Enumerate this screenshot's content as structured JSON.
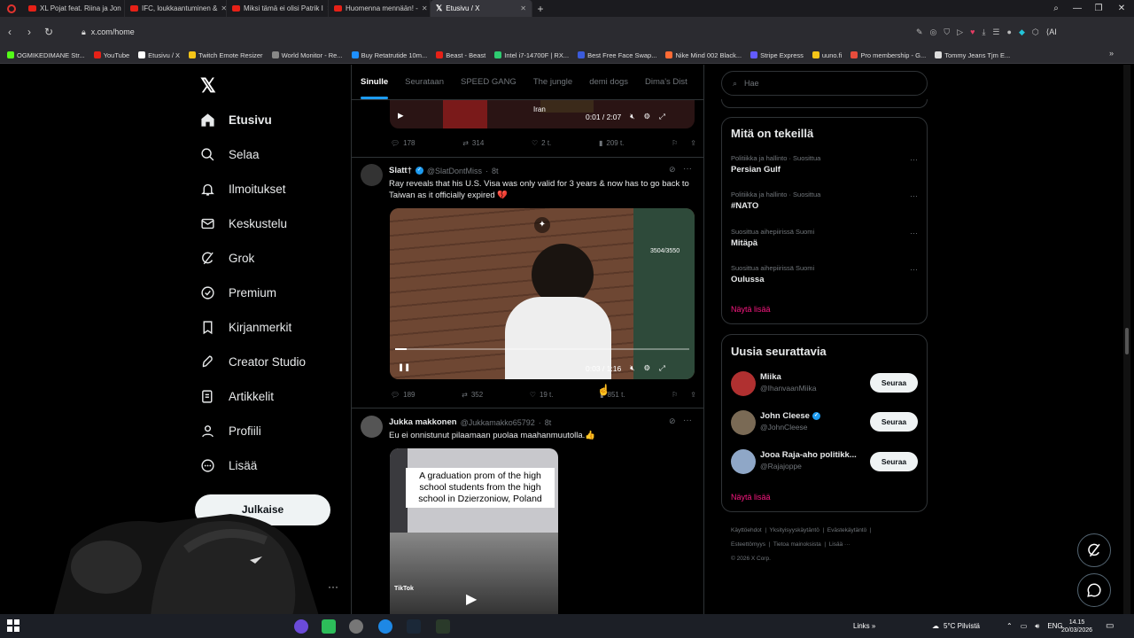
{
  "browser": {
    "tabs": [
      {
        "title": "XL Pojat feat. Riina ja Jon",
        "icon": "youtube-icon"
      },
      {
        "title": "IFC, loukkaantuminen &",
        "icon": "youtube-icon"
      },
      {
        "title": "Miksi tämä ei olisi Patrik I",
        "icon": "youtube-icon"
      },
      {
        "title": "Huomenna mennään! -",
        "icon": "youtube-icon"
      },
      {
        "title": "Etusivu / X",
        "icon": "x-icon",
        "active": true
      }
    ],
    "url": "x.com/home",
    "bookmarks": [
      {
        "label": "OGMIKEDIMANE Str...",
        "color": "#53fc18"
      },
      {
        "label": "YouTube",
        "color": "#e62117"
      },
      {
        "label": "Etusivu / X",
        "color": "#ffffff"
      },
      {
        "label": "Twitch Emote Resizer",
        "color": "#f5c518"
      },
      {
        "label": "World Monitor - Re...",
        "color": "#888888"
      },
      {
        "label": "Buy Retatrutide 10m...",
        "color": "#1e90ff"
      },
      {
        "label": "Beast - Beast",
        "color": "#e62117"
      },
      {
        "label": "Intel i7-14700F | RX...",
        "color": "#2ecc71"
      },
      {
        "label": "Best Free Face Swap...",
        "color": "#3b5bdb"
      },
      {
        "label": "Nike Mind 002 Black...",
        "color": "#ff6b35"
      },
      {
        "label": "Stripe Express",
        "color": "#635bff"
      },
      {
        "label": "uuno.fi",
        "color": "#f5c518"
      },
      {
        "label": "Pro membership - G...",
        "color": "#e74c3c"
      },
      {
        "label": "Tommy Jeans Tjm E...",
        "color": "#dddddd"
      }
    ],
    "ai_label": "AI"
  },
  "sidebar": {
    "items": [
      {
        "label": "Etusivu",
        "icon": "home-icon",
        "active": true
      },
      {
        "label": "Selaa",
        "icon": "search-icon"
      },
      {
        "label": "Ilmoitukset",
        "icon": "bell-icon"
      },
      {
        "label": "Keskustelu",
        "icon": "mail-icon"
      },
      {
        "label": "Grok",
        "icon": "grok-icon"
      },
      {
        "label": "Premium",
        "icon": "verified-icon"
      },
      {
        "label": "Kirjanmerkit",
        "icon": "bookmark-icon"
      },
      {
        "label": "Creator Studio",
        "icon": "rocket-icon"
      },
      {
        "label": "Artikkelit",
        "icon": "article-icon"
      },
      {
        "label": "Profiili",
        "icon": "person-icon"
      },
      {
        "label": "Lisää",
        "icon": "more-circle-icon"
      }
    ],
    "post_button": "Julkaise"
  },
  "feed": {
    "tabs": [
      "Sinulle",
      "Seurataan",
      "SPEED GANG",
      "The jungle",
      "demi dogs",
      "Dima's Dist"
    ],
    "tweet0": {
      "video_caption": "Iran",
      "time": "0:01 / 2:07",
      "replies": "178",
      "reposts": "314",
      "likes": "2 t.",
      "views": "209 t."
    },
    "tweet1": {
      "name": "Slatt†",
      "handle": "@SlatDontMiss",
      "age": "8t",
      "text": "Ray reveals that his U.S. Visa was only valid for 3 years & now has to go back to Taiwan as it officially expired 💔",
      "video_counter": "3504/3550",
      "time": "0:03 / 1:16",
      "replies": "189",
      "reposts": "352",
      "likes": "19 t.",
      "views": "851 t."
    },
    "tweet2": {
      "name": "Jukka makkonen",
      "handle": "@Jukkamakko65792",
      "age": "8t",
      "text": "Eu ei onnistunut pilaamaan puolaa maahanmuutolla.👍",
      "image_caption": "A graduation prom of the high school students from the high school in Dzierzoniow, Poland",
      "watermark": "TikTok"
    }
  },
  "right": {
    "search_placeholder": "Hae",
    "trends_title": "Mitä on tekeillä",
    "trends": [
      {
        "category": "Politiikka ja hallinto · Suosittua",
        "name": "Persian Gulf"
      },
      {
        "category": "Politiikka ja hallinto · Suosittua",
        "name": "#NATO"
      },
      {
        "category": "Suosittua aihepiirissä Suomi",
        "name": "Mitäpä"
      },
      {
        "category": "Suosittua aihepiirissä Suomi",
        "name": "Oulussa"
      }
    ],
    "show_more": "Näytä lisää",
    "follow_title": "Uusia seurattavia",
    "follow": [
      {
        "name": "Miika",
        "handle": "@IhanvaanMiika",
        "button": "Seuraa"
      },
      {
        "name": "John Cleese",
        "handle": "@JohnCleese",
        "button": "Seuraa",
        "verified": true
      },
      {
        "name": "Jooa Raja-aho politikk...",
        "handle": "@Rajajoppe",
        "button": "Seuraa"
      }
    ],
    "footer": {
      "links": [
        "Käyttöehdot",
        "Yksityisyyskäytäntö",
        "Evästekäytäntö",
        "Esteettömyys",
        "Tietoa mainoksista",
        "Lisää ···"
      ],
      "copyright": "© 2026 X Corp."
    }
  },
  "taskbar": {
    "links": "Links",
    "weather": "5°C Pilvistä",
    "lang": "ENG",
    "time": "14.15",
    "date": "20/03/2026"
  }
}
